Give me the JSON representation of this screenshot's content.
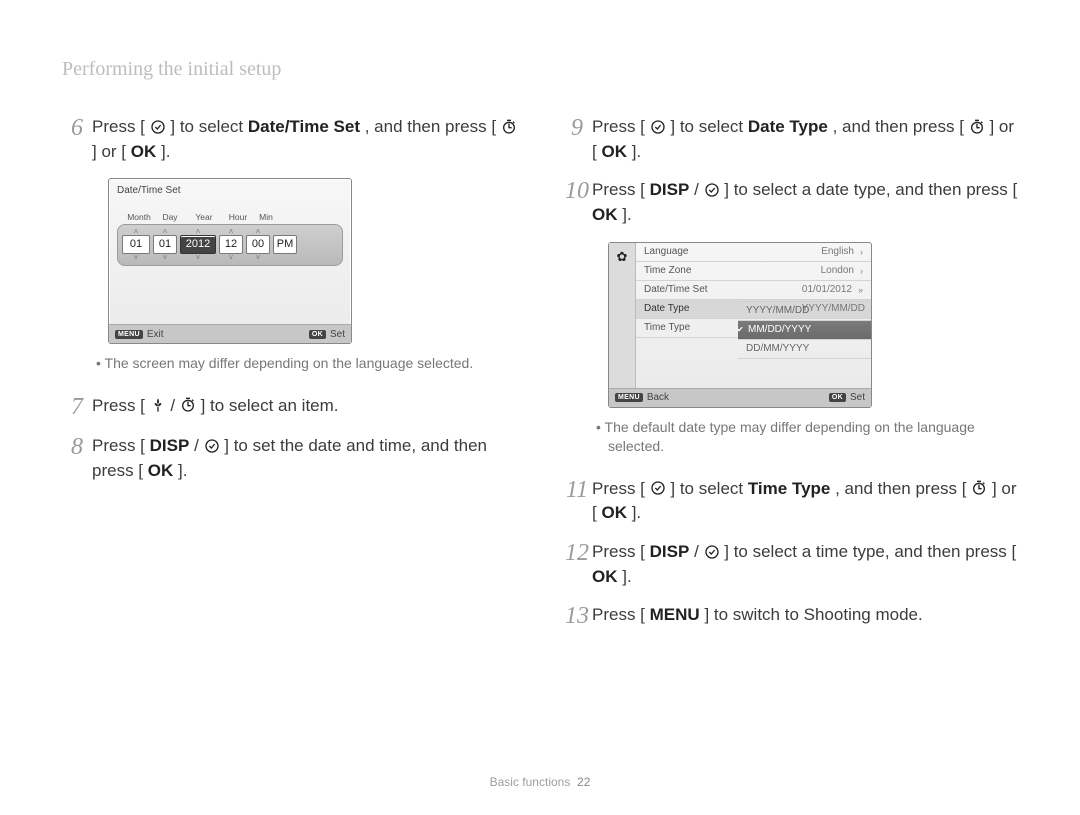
{
  "page_title": "Performing the initial setup",
  "steps": {
    "s6": {
      "num": "6",
      "t1": "Press [",
      "t2": "] to select ",
      "bold": "Date/Time Set",
      "t3": ", and then press [",
      "t4": "] or [",
      "t5": "]."
    },
    "s7": {
      "num": "7",
      "t1": "Press [",
      "t2": "] to select an item."
    },
    "s8": {
      "num": "8",
      "t1": "Press [",
      "t2": "] to set the date and time, and then press [",
      "t3": "]."
    },
    "s9": {
      "num": "9",
      "t1": "Press [",
      "t2": "] to select ",
      "bold": "Date Type",
      "t3": ", and then press [",
      "t4": "] or [",
      "t5": "]."
    },
    "s10": {
      "num": "10",
      "t1": "Press [",
      "t2": "] to select a date type, and then press [",
      "t3": "]."
    },
    "s11": {
      "num": "11",
      "t1": "Press [",
      "t2": "] to select ",
      "bold": "Time Type",
      "t3": ", and then press [",
      "t4": "] or [",
      "t5": "]."
    },
    "s12": {
      "num": "12",
      "t1": "Press [",
      "t2": "] to select a time type, and then press [",
      "t3": "]."
    },
    "s13": {
      "num": "13",
      "t1": "Press [",
      "t2": "] to switch to Shooting mode."
    }
  },
  "note1": "The screen may differ depending on the language selected.",
  "note2": "The default date type may differ depending on the language selected.",
  "lcd1": {
    "title": "Date/Time Set",
    "labels": {
      "month": "Month",
      "day": "Day",
      "year": "Year",
      "hour": "Hour",
      "min": "Min"
    },
    "values": {
      "month": "01",
      "day": "01",
      "year": "2012",
      "hour": "12",
      "min": "00",
      "ampm": "PM"
    },
    "footer": {
      "left_tag": "MENU",
      "left": "Exit",
      "right_tag": "OK",
      "right": "Set"
    }
  },
  "lcd2": {
    "rows": {
      "language": {
        "label": "Language",
        "value": "English"
      },
      "timezone": {
        "label": "Time Zone",
        "value": "London"
      },
      "datetime": {
        "label": "Date/Time Set",
        "value": "01/01/2012"
      },
      "datetype": {
        "label": "Date Type",
        "opt1": "YYYY/MM/DD",
        "opt2": "MM/DD/YYYY",
        "opt3": "DD/MM/YYYY"
      },
      "timetype": {
        "label": "Time Type"
      }
    },
    "footer": {
      "left_tag": "MENU",
      "left": "Back",
      "right_tag": "OK",
      "right": "Set"
    }
  },
  "footer": {
    "section": "Basic functions",
    "page": "22"
  }
}
